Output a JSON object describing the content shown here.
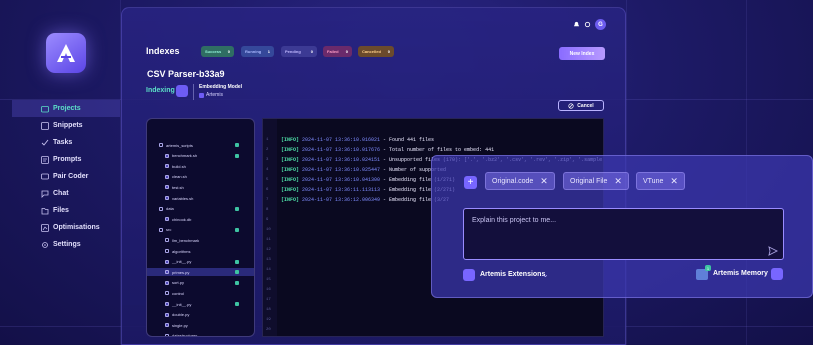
{
  "app": {
    "logo_icon": "artemis-logo-icon",
    "avatar_letter": "G",
    "accent": "#5ce0c8",
    "brand": "#7866ff"
  },
  "sidebar": {
    "items": [
      {
        "label": "Projects",
        "icon": "folder-icon",
        "active": true
      },
      {
        "label": "Snippets",
        "icon": "snippet-icon",
        "active": false
      },
      {
        "label": "Tasks",
        "icon": "tasks-icon",
        "active": false
      },
      {
        "label": "Prompts",
        "icon": "prompts-icon",
        "active": false
      },
      {
        "label": "Pair Coder",
        "icon": "pair-coder-icon",
        "active": false
      },
      {
        "label": "Chat",
        "icon": "chat-icon",
        "active": false
      },
      {
        "label": "Files",
        "icon": "files-icon",
        "active": false
      },
      {
        "label": "Optimisations",
        "icon": "optimisations-icon",
        "active": false
      },
      {
        "label": "Settings",
        "icon": "settings-icon",
        "active": false
      }
    ]
  },
  "header": {
    "title": "Indexes",
    "badges": [
      {
        "label": "Success",
        "count": "0"
      },
      {
        "label": "Running",
        "count": "1"
      },
      {
        "label": "Pending",
        "count": "0"
      },
      {
        "label": "Failed",
        "count": "0"
      },
      {
        "label": "Cancelled",
        "count": "0"
      }
    ],
    "new_index_label": "New Index"
  },
  "project": {
    "title": "CSV Parser-b33a9",
    "status": "Indexing",
    "embedding_label": "Embedding Model",
    "embedding_model": "Artemis",
    "cancel_label": "Cancel"
  },
  "tree": [
    {
      "name": "artemis_scripts",
      "type": "folder",
      "checked": true
    },
    {
      "name": "benchmark.sh",
      "type": "file",
      "checked": true
    },
    {
      "name": "build.sh",
      "type": "file",
      "checked": false
    },
    {
      "name": "clean.sh",
      "type": "file",
      "checked": false
    },
    {
      "name": "test.sh",
      "type": "file",
      "checked": false
    },
    {
      "name": "variables.sh",
      "type": "file",
      "checked": false
    },
    {
      "name": "data",
      "type": "folder",
      "checked": true
    },
    {
      "name": "chinook.db",
      "type": "file",
      "checked": false
    },
    {
      "name": "src",
      "type": "folder",
      "checked": true
    },
    {
      "name": "llm_benchmark",
      "type": "folder",
      "checked": false
    },
    {
      "name": "algorithms",
      "type": "folder",
      "checked": false
    },
    {
      "name": "__init__.py",
      "type": "file",
      "checked": true
    },
    {
      "name": "primes.py",
      "type": "file",
      "checked": true
    },
    {
      "name": "sort.py",
      "type": "file",
      "checked": true
    },
    {
      "name": "control",
      "type": "folder",
      "checked": false
    },
    {
      "name": "__init__.py",
      "type": "file",
      "checked": true
    },
    {
      "name": "double.py",
      "type": "file",
      "checked": false
    },
    {
      "name": "single.py",
      "type": "file",
      "checked": false
    },
    {
      "name": "datastructures",
      "type": "folder",
      "checked": false
    }
  ],
  "log": {
    "lines": [
      {
        "level": "[INFO]",
        "ts": "2024-11-07 13:36:10.016021",
        "msg": " - Found 441 files"
      },
      {
        "level": "[INFO]",
        "ts": "2024-11-07 13:36:10.017676",
        "msg": " - Total number of files to embed: 441"
      },
      {
        "level": "[INFO]",
        "ts": "2024-11-07 13:36:10.024151",
        "msg": " - Unsupported files (170): ['.', '.bz2', '.csv', '.rev', '.zip', '.sample', '.pypa', '.html', '.idx', '.pack']"
      },
      {
        "level": "[INFO]",
        "ts": "2024-11-07 13:36:10.025447",
        "msg": " - Number of supported"
      },
      {
        "level": "[INFO]",
        "ts": "2024-11-07 13:36:10.041300",
        "msg": " - Embedding file (1/271)"
      },
      {
        "level": "[INFO]",
        "ts": "2024-11-07 13:36:11.113113",
        "msg": " - Embedding file (2/271)"
      },
      {
        "level": "[INFO]",
        "ts": "2024-11-07 13:36:12.006349",
        "msg": " - Embedding file (3/27"
      }
    ],
    "line_numbers": [
      "1",
      "2",
      "3",
      "4",
      "5",
      "6",
      "7",
      "8",
      "9",
      "10",
      "11",
      "12",
      "13",
      "14",
      "15",
      "16",
      "17",
      "18",
      "19",
      "20",
      "21"
    ]
  },
  "chat": {
    "chips": [
      "Original.code",
      "Original File",
      "VTune"
    ],
    "input_placeholder": "Explain this project to me...",
    "extensions_label": "Artemis Extensions",
    "memory_label": "Artemis Memory",
    "memory_count": "1"
  }
}
